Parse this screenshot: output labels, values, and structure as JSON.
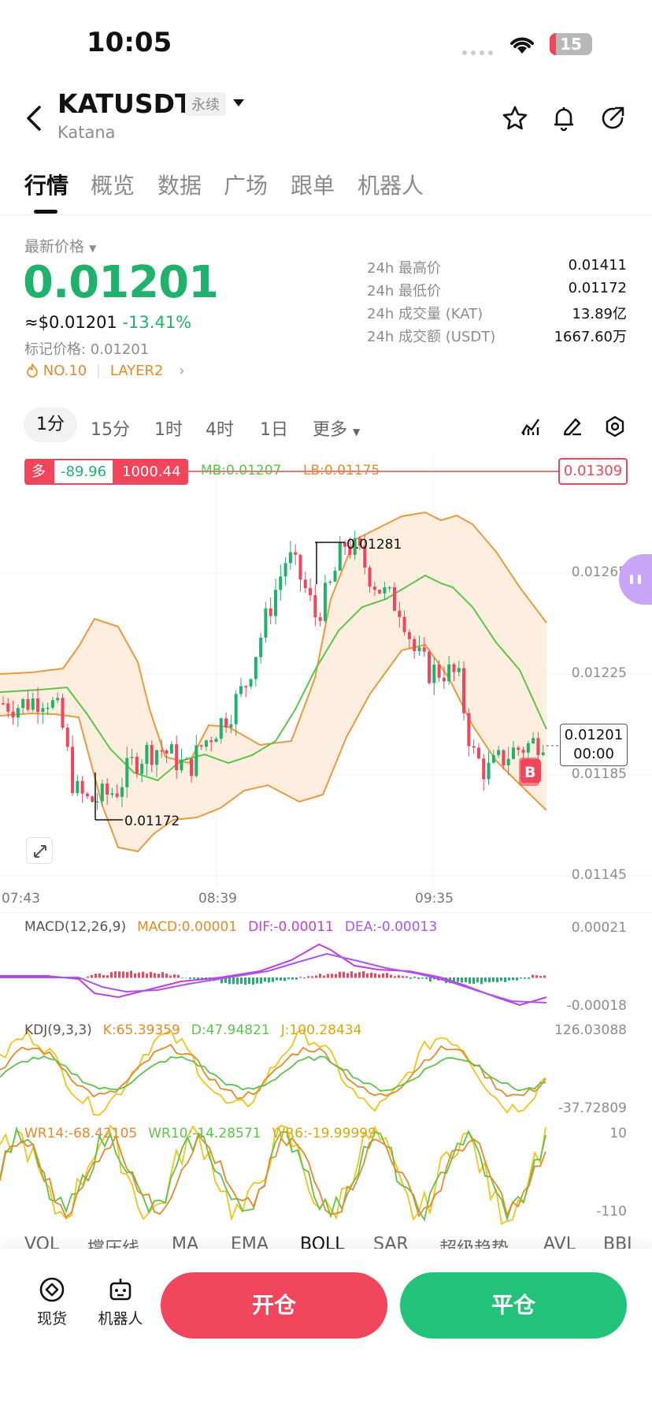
{
  "status_bar": {
    "time": "10:05",
    "battery": "15"
  },
  "header": {
    "symbol": "KATUSDT",
    "contract_type": "永续",
    "name": "Katana"
  },
  "tabs": [
    "行情",
    "概览",
    "数据",
    "广场",
    "跟单",
    "机器人"
  ],
  "active_tab": 0,
  "price": {
    "label": "最新价格",
    "last": "0.01201",
    "usd": "≈$0.01201",
    "change": "-13.41%",
    "mark": "标记价格: 0.01201",
    "rank_tag": "NO.10",
    "sector_tag": "LAYER2"
  },
  "stats": [
    {
      "label": "24h 最高价",
      "value": "0.01411"
    },
    {
      "label": "24h 最低价",
      "value": "0.01172"
    },
    {
      "label": "24h 成交量 (KAT)",
      "value": "13.89亿"
    },
    {
      "label": "24h 成交额 (USDT)",
      "value": "1667.60万"
    }
  ],
  "timeframes": [
    "1分",
    "15分",
    "1时",
    "4时",
    "1日",
    "更多"
  ],
  "active_timeframe": 0,
  "position_badge": {
    "side": "多",
    "pnl": "-89.96",
    "qty": "1000.44"
  },
  "boll_legend": {
    "mb": "MB:0.01207",
    "lb": "LB:0.01175"
  },
  "liquidation_price": "0.01309",
  "price_axis": [
    "0.01265",
    "0.01225",
    "0.01185",
    "0.01145"
  ],
  "time_axis": [
    "07:43",
    "08:39",
    "09:35"
  ],
  "current_price_box": {
    "price": "0.01201",
    "countdown": "00:00"
  },
  "chart_annotations": {
    "high": "0.01281",
    "low": "0.01172",
    "buy_marker": "B"
  },
  "indicators": {
    "macd": {
      "name": "MACD(12,26,9)",
      "macd": "MACD:0.00001",
      "dif": "DIF:-0.00011",
      "dea": "DEA:-0.00013",
      "axis_top": "0.00021",
      "axis_bottom": "-0.00018"
    },
    "kdj": {
      "name": "KDJ(9,3,3)",
      "k": "K:65.39359",
      "d": "D:47.94821",
      "j": "J:100.28434",
      "axis_top": "126.03088",
      "axis_bottom": "-37.72809"
    },
    "wr": {
      "wr14": "WR14:-68.42105",
      "wr10": "WR10:-14.28571",
      "wr6": "WR6:-19.99999",
      "axis_top": "10",
      "axis_bottom": "-110"
    }
  },
  "indicator_tabs": [
    "VOL",
    "撑压线",
    "MA",
    "EMA",
    "BOLL",
    "SAR",
    "超级趋势",
    "AVL",
    "BBI"
  ],
  "bottom_bar": {
    "spot": "现货",
    "bot": "机器人",
    "open": "开仓",
    "close": "平仓"
  },
  "chart_data": {
    "type": "line",
    "title": "",
    "x_ticks": [
      "07:43",
      "08:39",
      "09:35"
    ],
    "ylim": [
      0.01145,
      0.01309
    ],
    "series": [
      {
        "name": "",
        "values": [
          0.01215,
          0.01214,
          0.01216,
          0.01218,
          0.0121,
          0.0118,
          0.01175,
          0.01177,
          0.0118,
          0.0119,
          0.01195,
          0.01197,
          0.01193,
          0.01188,
          0.01198,
          0.01205,
          0.01212,
          0.01222,
          0.0124,
          0.01258,
          0.01275,
          0.01265,
          0.0125,
          0.01262,
          0.0128,
          0.01276,
          0.01265,
          0.01258,
          0.01254,
          0.01235,
          0.01228,
          0.01228,
          0.01226,
          0.01195,
          0.01187,
          0.01192,
          0.01196,
          0.01198,
          0.01201
        ]
      }
    ]
  }
}
